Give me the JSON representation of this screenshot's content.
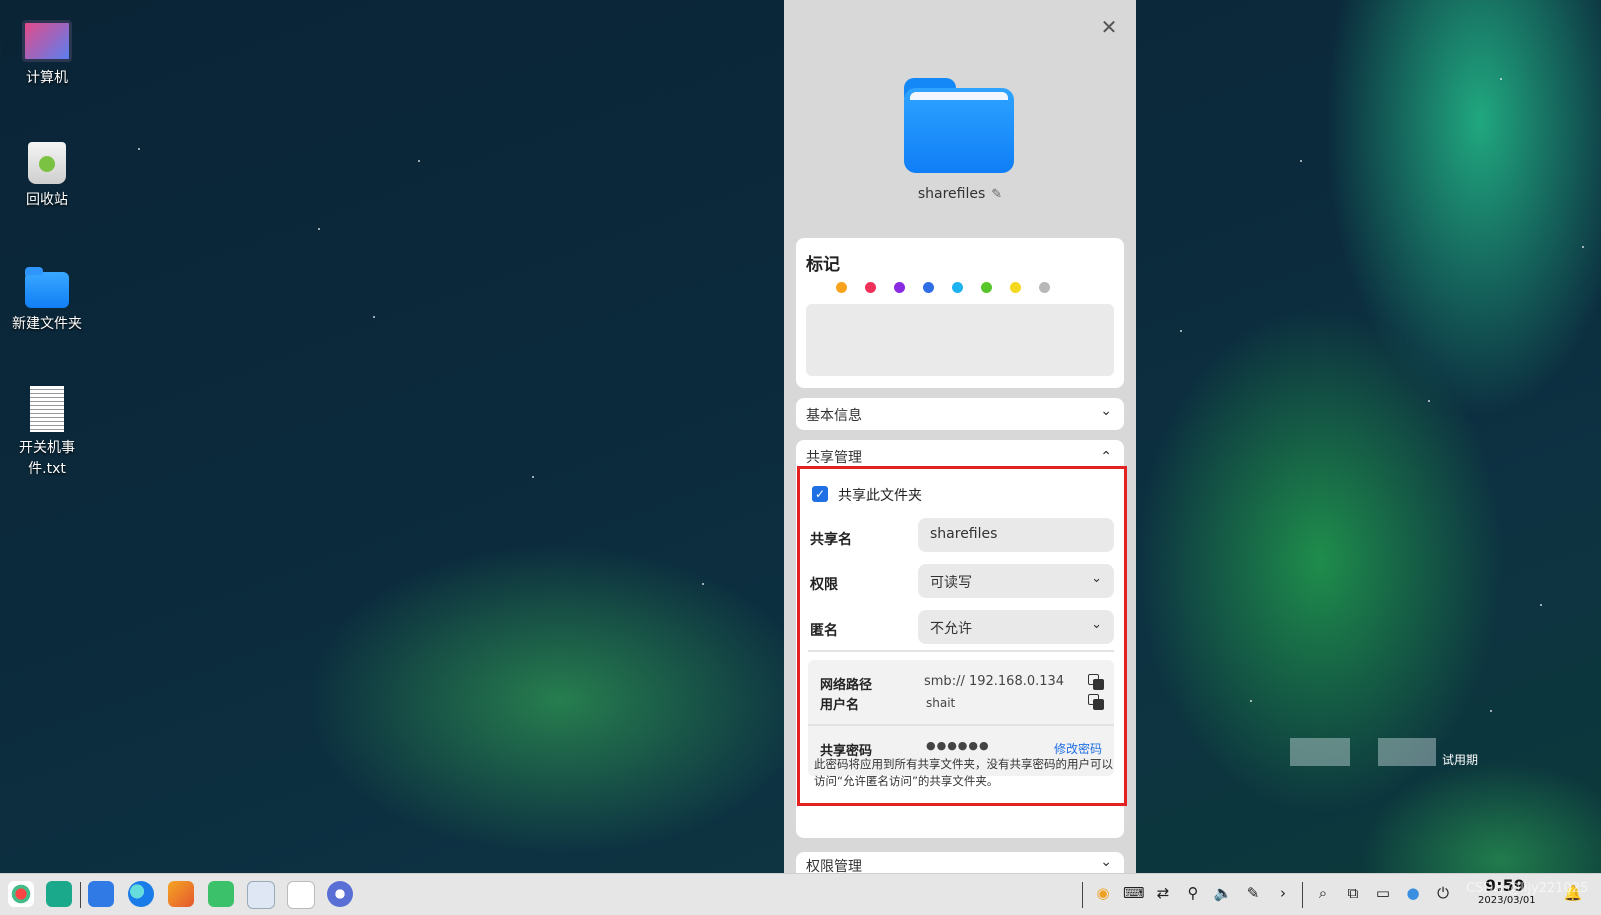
{
  "desktop": {
    "icons": [
      {
        "label": "计算机"
      },
      {
        "label": "回收站"
      },
      {
        "label": "新建文件夹"
      },
      {
        "label": "开关机事件.txt"
      }
    ]
  },
  "panel": {
    "close_icon": "close-icon",
    "folder_name": "sharefiles",
    "tags": {
      "title": "标记",
      "colors": [
        "#f9a21b",
        "#f1305a",
        "#8a2be2",
        "#2f6fe6",
        "#1eb2f0",
        "#58c52a",
        "#f5d820",
        "#b8b8b8"
      ]
    },
    "basic_info": {
      "title": "基本信息"
    },
    "share": {
      "title": "共享管理",
      "share_checkbox_label": "共享此文件夹",
      "share_checked": true,
      "share_name_label": "共享名",
      "share_name_value": "sharefiles",
      "permission_label": "权限",
      "permission_value": "可读写",
      "anonymous_label": "匿名",
      "anonymous_value": "不允许",
      "network_path_label": "网络路径",
      "network_path_value": "smb:// 192.168.0.134",
      "username_label": "用户名",
      "username_value": "shait",
      "password_label": "共享密码",
      "password_value": "●●●●●●",
      "change_password": "修改密码",
      "note": "此密码将应用到所有共享文件夹，没有共享密码的用户可以访问“允许匿名访问”的共享文件夹。"
    },
    "permission_mgmt": {
      "title": "权限管理"
    }
  },
  "watermark": {
    "trial": "试用期",
    "csdn": "CSDN @lijy221025"
  },
  "taskbar": {
    "apps": [
      "launcher-icon",
      "multitask-icon",
      "app-store-icon",
      "browser-icon",
      "photos-icon",
      "music-icon",
      "docs-icon",
      "calendar-icon",
      "settings-icon"
    ],
    "clock_time": "9:59",
    "clock_date": "2023/03/01"
  }
}
